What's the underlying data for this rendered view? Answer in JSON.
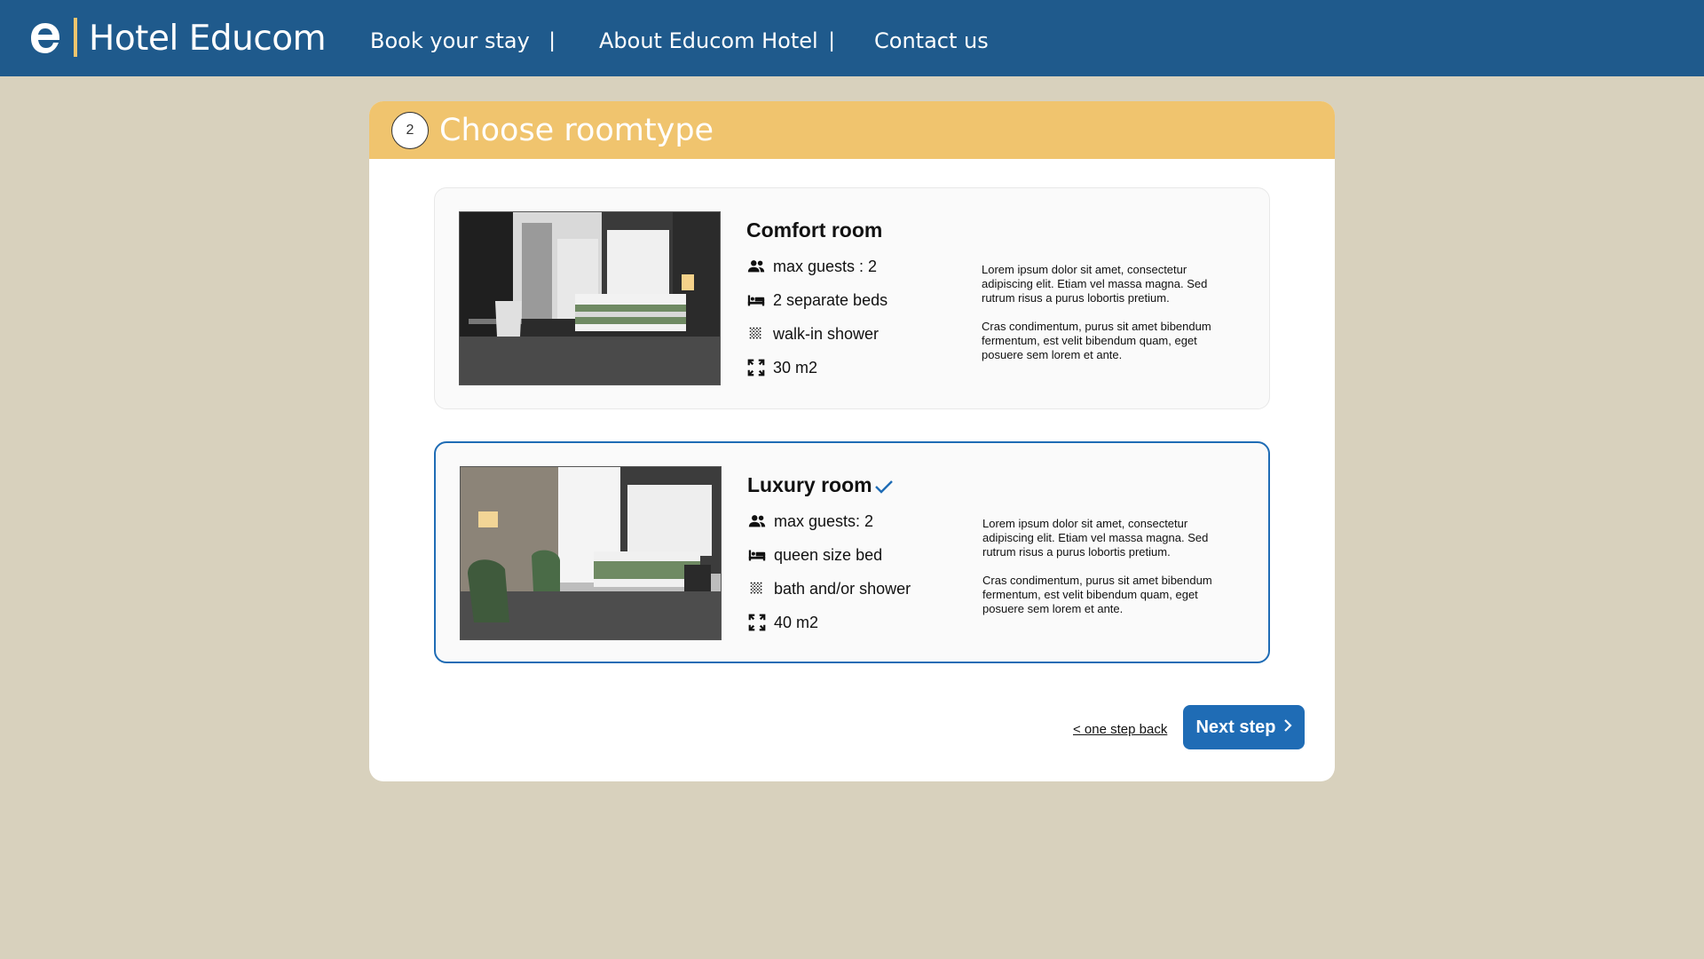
{
  "header": {
    "brand": "Hotel Educom",
    "nav": [
      {
        "label": "Book your stay"
      },
      {
        "label": "About Educom Hotel"
      },
      {
        "label": "Contact us"
      }
    ],
    "separator": "|"
  },
  "step": {
    "number": "2",
    "title": "Choose roomtype"
  },
  "rooms": [
    {
      "name": "Comfort room",
      "selected": false,
      "features": {
        "guests": "max guests : 2",
        "beds": "2 separate beds",
        "bath": "walk-in shower",
        "size": "30 m2"
      },
      "description": [
        "Lorem ipsum dolor sit amet, consectetur adipiscing elit. Etiam vel massa magna. Sed rutrum risus a purus lobortis pretium.",
        "Cras condimentum, purus sit amet bibendum fermentum, est velit bibendum quam, eget posuere sem lorem et ante."
      ]
    },
    {
      "name": "Luxury room",
      "selected": true,
      "features": {
        "guests": "max guests: 2",
        "beds": "queen size bed",
        "bath": "bath and/or shower",
        "size": "40 m2"
      },
      "description": [
        "Lorem ipsum dolor sit amet, consectetur adipiscing elit. Etiam vel massa magna. Sed rutrum risus a purus lobortis pretium.",
        "Cras condimentum, purus sit amet bibendum fermentum, est velit bibendum quam, eget posuere sem lorem et ante."
      ]
    }
  ],
  "actions": {
    "back_label": "< one step back",
    "next_label": "Next step",
    "next_icon": "chevron-right-icon"
  },
  "colors": {
    "header_bg": "#1f5a8c",
    "accent_yellow": "#f0c46e",
    "primary_button": "#1f6cb5",
    "page_bg": "#d8d1bd"
  }
}
